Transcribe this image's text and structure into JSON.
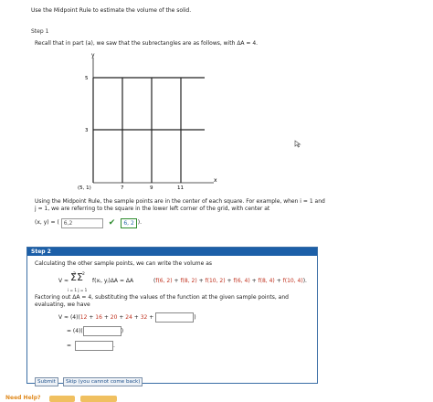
{
  "intro_text": "Use the Midpoint Rule to estimate the volume of the solid.",
  "step1": {
    "label": "Step 1",
    "recall_text": "Recall that in part (a), we saw that the subrectangles are as follows, with ΔA = 4.",
    "graph": {
      "y_axis_label": "y",
      "x_axis_label": "x",
      "y_ticks": [
        "5",
        "3"
      ],
      "x_ticks": [
        "(5, 1)",
        "7",
        "9",
        "11"
      ]
    },
    "paragraph": "Using the Midpoint Rule, the sample points are in the center of each square. For example, when i = 1 and j = 1, we are referring to the square in the lower left corner of the grid, with center at",
    "xy_prefix": "(x, y) = (",
    "xy_input_value": "6,2",
    "xy_answer": "6, 2",
    "xy_suffix": ")."
  },
  "step2": {
    "label": "Step 2",
    "calc_text": "Calculating the other sample points, we can write the volume as",
    "formula_lhs": "V ≈",
    "sum_top1": "3",
    "sum_top2": "2",
    "sum_bottom": "i = 1 j = 1",
    "formula_middle": "f(xᵢ, yⱼ)ΔA = ΔA",
    "f_terms": [
      "f(6, 2)",
      "f(8, 2)",
      "f(10, 2)",
      "f(6, 4)",
      "f(8, 4)",
      "f(10, 4)"
    ],
    "factoring_text": "Factoring out ΔA = 4, substituting the values of the function at the given sample points, and evaluating, we have",
    "v_line_prefix": "V ≈ (4)(",
    "v_line_values": [
      "12",
      "16",
      "20",
      "24",
      "32"
    ],
    "v_line_suffix": ")",
    "line2_prefix": "= (4)(",
    "line2_suffix": ")",
    "line3_prefix": "=",
    "line3_suffix": "."
  },
  "buttons": {
    "submit": "Submit",
    "skip": "Skip (you cannot come back)"
  },
  "footer": {
    "need_help": "Need Help?"
  },
  "colors": {
    "accent_blue": "#1c5fa8",
    "correct_green": "#2e8b2e",
    "red_values": "#c0311e"
  }
}
